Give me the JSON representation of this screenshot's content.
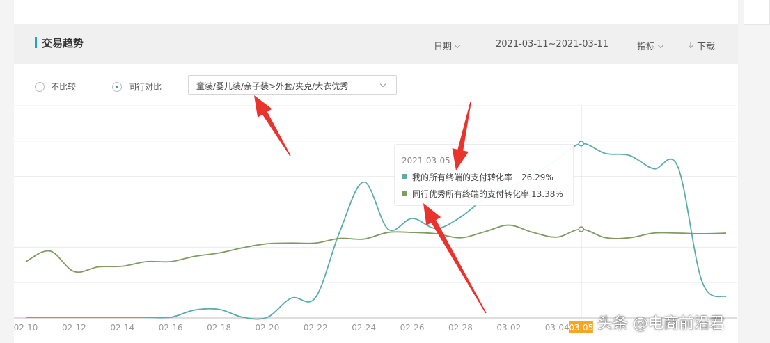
{
  "header": {
    "title": "交易趋势",
    "date_label": "日期",
    "date_range": "2021-03-11~2021-03-11",
    "metric_label": "指标",
    "download_label": "下载"
  },
  "compare": {
    "option_none": "不比较",
    "option_peer": "同行对比",
    "selected": "peer",
    "category": "童装/婴儿装/亲子装>外套/夹克/大衣优秀"
  },
  "tooltip": {
    "date": "2021-03-05",
    "rows": [
      {
        "label": "我的所有终端的支付转化率",
        "value": "26.29%"
      },
      {
        "label": "同行优秀所有终端的支付转化率",
        "value": "13.38%"
      }
    ]
  },
  "watermark": "头条 @电商前沿君",
  "colors": {
    "mine": "#5aacad",
    "peer": "#7f9b62",
    "highlight_label_bg": "#f5a623",
    "arrow": "#e8342c"
  },
  "chart_data": {
    "type": "line",
    "x": [
      "02-10",
      "02-11",
      "02-12",
      "02-13",
      "02-14",
      "02-15",
      "02-16",
      "02-17",
      "02-18",
      "02-19",
      "02-20",
      "02-21",
      "02-22",
      "02-23",
      "02-24",
      "02-25",
      "02-26",
      "02-27",
      "02-28",
      "03-01",
      "03-02",
      "03-03",
      "03-04",
      "03-05",
      "03-06",
      "03-07",
      "03-08",
      "03-09",
      "03-10",
      "03-11"
    ],
    "tick_labels": [
      "02-10",
      "02-12",
      "02-14",
      "02-16",
      "02-18",
      "02-20",
      "02-22",
      "02-24",
      "02-26",
      "02-28",
      "03-02",
      "03-04",
      "03-05"
    ],
    "highlight_x": "03-05",
    "ylim": [
      0,
      32
    ],
    "grid": true,
    "series": [
      {
        "name": "我的所有终端的支付转化率",
        "values": [
          0.1,
          0.1,
          0.1,
          0.1,
          0.1,
          0.1,
          0.1,
          1.2,
          1.3,
          0.1,
          0.1,
          3.0,
          3.1,
          13.0,
          20.5,
          13.4,
          15.0,
          13.5,
          15.2,
          18.0,
          19.6,
          21.5,
          23.9,
          26.29,
          24.8,
          24.5,
          22.5,
          22.8,
          5.5,
          3.2
        ]
      },
      {
        "name": "同行优秀所有终端的支付转化率",
        "values": [
          8.5,
          10.1,
          7.0,
          7.7,
          7.8,
          8.5,
          8.5,
          9.3,
          9.8,
          10.6,
          11.2,
          11.3,
          11.3,
          12.0,
          11.9,
          12.9,
          12.9,
          12.7,
          12.1,
          13.0,
          14.0,
          12.9,
          12.2,
          13.38,
          12.1,
          12.1,
          12.8,
          12.8,
          12.7,
          12.8
        ]
      }
    ]
  }
}
